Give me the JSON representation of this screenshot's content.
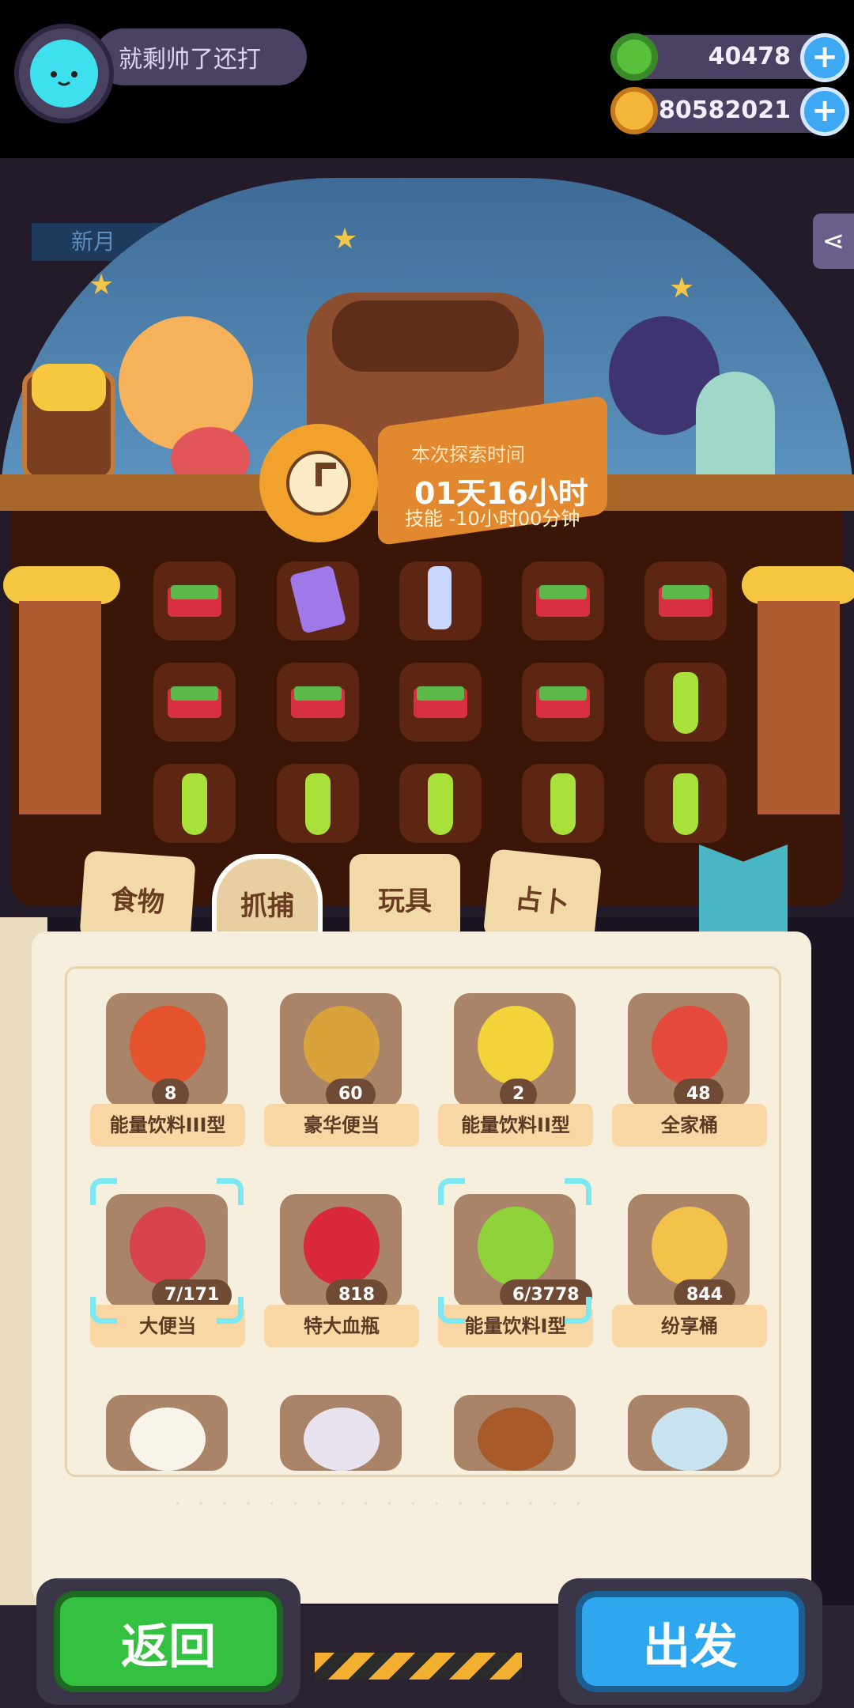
{
  "player": {
    "name": "就剩帅了还打"
  },
  "resources": [
    {
      "icon": "donut-coin-icon",
      "value": "40478"
    },
    {
      "icon": "planet-coin-icon",
      "value": "80582021"
    }
  ],
  "scene": {
    "sign_text": "新月",
    "timer_label": "本次探索时间",
    "timer_value": "01天16小时",
    "skill_text": "技能 -10小时00分钟"
  },
  "backpack_slots": [
    "bento",
    "card",
    "trophy",
    "bento",
    "bento",
    "bento",
    "bento",
    "bento",
    "bento",
    "bottle",
    "bottle",
    "bottle",
    "bottle",
    "bottle",
    "bottle"
  ],
  "tabs": [
    {
      "label": "食物",
      "selected": false
    },
    {
      "label": "抓捕",
      "selected": true
    },
    {
      "label": "玩具",
      "selected": false
    },
    {
      "label": "占卜",
      "selected": false
    }
  ],
  "items": [
    {
      "name": "能量饮料III型",
      "count": "8",
      "icon": "energy-drink-iii-icon",
      "selected": false
    },
    {
      "name": "豪华便当",
      "count": "60",
      "icon": "deluxe-bento-icon",
      "selected": false
    },
    {
      "name": "能量饮料II型",
      "count": "2",
      "icon": "energy-drink-ii-icon",
      "selected": false
    },
    {
      "name": "全家桶",
      "count": "48",
      "icon": "family-bucket-icon",
      "selected": false
    },
    {
      "name": "大便当",
      "count": "7/171",
      "icon": "big-bento-icon",
      "selected": true
    },
    {
      "name": "特大血瓶",
      "count": "818",
      "icon": "large-health-potion-icon",
      "selected": false
    },
    {
      "name": "能量饮料I型",
      "count": "6/3778",
      "icon": "energy-drink-i-icon",
      "selected": true
    },
    {
      "name": "纷享桶",
      "count": "844",
      "icon": "sharing-bucket-icon",
      "selected": false
    },
    {
      "name": "",
      "count": "",
      "icon": "rice-bowl-icon",
      "selected": false
    },
    {
      "name": "",
      "count": "",
      "icon": "potion-flask-icon",
      "selected": false
    },
    {
      "name": "",
      "count": "",
      "icon": "roast-chicken-icon",
      "selected": false
    },
    {
      "name": "",
      "count": "",
      "icon": "test-tube-icon",
      "selected": false
    }
  ],
  "buttons": {
    "back": "返回",
    "go": "出发"
  },
  "colors": {
    "accent_blue": "#2fa7ee",
    "accent_green": "#34c040",
    "selection": "#7be8f2"
  }
}
